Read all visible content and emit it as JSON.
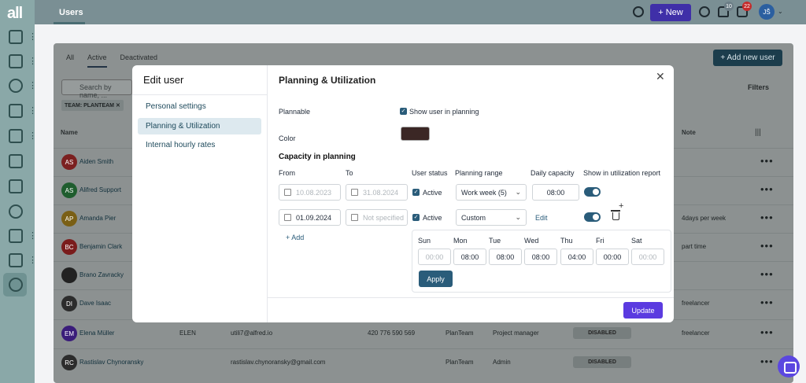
{
  "app": {
    "logo": "all"
  },
  "topbar": {
    "tab_users": "Users",
    "new_button": "New",
    "new_plus": "+",
    "notif_badge_1": "10",
    "notif_badge_2": "22",
    "avatar_initials": "JŠ"
  },
  "page": {
    "subtabs": [
      "All",
      "Active",
      "Deactivated"
    ],
    "add_user_button": "+ Add new user",
    "filters": "Filters",
    "search_placeholder": "Search by name, ...",
    "team_chip": "TEAM: PLANTEAM",
    "chip_close": "✕",
    "col_name": "Name",
    "col_note": "Note",
    "col_settings": "|||",
    "rows": [
      {
        "initials": "AS",
        "color": "#7b2020",
        "name": "Aiden Smith",
        "note": ""
      },
      {
        "initials": "AS",
        "color": "#1f5d2e",
        "name": "Alifred Support",
        "note": ""
      },
      {
        "initials": "AP",
        "color": "#7a5f15",
        "name": "Amanda Pier",
        "note": "4days per week"
      },
      {
        "initials": "BC",
        "color": "#7a1c1c",
        "name": "Benjamin Clark",
        "note": "part time"
      },
      {
        "initials": "",
        "color": "#222222",
        "name": "Brano Zavracky",
        "note": ""
      },
      {
        "initials": "DI",
        "color": "#2c2c2c",
        "name": "Dave Isaac",
        "note": "freelancer"
      },
      {
        "initials": "EM",
        "color": "#3a1c7a",
        "name": "Elena Müller",
        "note": "freelancer",
        "code": "ELEN",
        "email": "utili7@alfred.io",
        "phone": "420 776 590 569",
        "team": "PlanTeam",
        "role": "Project manager",
        "status": "DISABLED"
      },
      {
        "initials": "RC",
        "color": "#2c2c2c",
        "name": "Rastislav Chynoransky",
        "note": "",
        "code": "",
        "email": "rastislav.chynoransky@gmail.com",
        "phone": "",
        "team": "PlanTeam",
        "role": "Admin",
        "status": "DISABLED"
      }
    ],
    "row_menu": "•••"
  },
  "modal": {
    "title": "Edit user",
    "close": "✕",
    "nav": [
      "Personal settings",
      "Planning & Utilization",
      "Internal hourly rates"
    ],
    "section_title": "Planning & Utilization",
    "plannable_label": "Plannable",
    "show_in_planning": "Show user in planning",
    "color_label": "Color",
    "capacity_title": "Capacity in planning",
    "headers": {
      "from": "From",
      "to": "To",
      "status": "User status",
      "range": "Planning range",
      "daily": "Daily capacity",
      "report": "Show in utilization report"
    },
    "rows": [
      {
        "from": "10.08.2023",
        "to": "31.08.2024",
        "status": "Active",
        "range": "Work week (5)",
        "daily": "08:00"
      },
      {
        "from": "01.09.2024",
        "to": "Not specified",
        "status": "Active",
        "range": "Custom",
        "daily_link": "Edit"
      }
    ],
    "add": "+ Add",
    "week": {
      "days": [
        "Sun",
        "Mon",
        "Tue",
        "Wed",
        "Thu",
        "Fri",
        "Sat"
      ],
      "values": [
        "00:00",
        "08:00",
        "08:00",
        "08:00",
        "04:00",
        "00:00",
        "00:00"
      ],
      "apply": "Apply"
    },
    "update": "Update",
    "check": "✓",
    "chev": "⌄",
    "plus": "+"
  }
}
